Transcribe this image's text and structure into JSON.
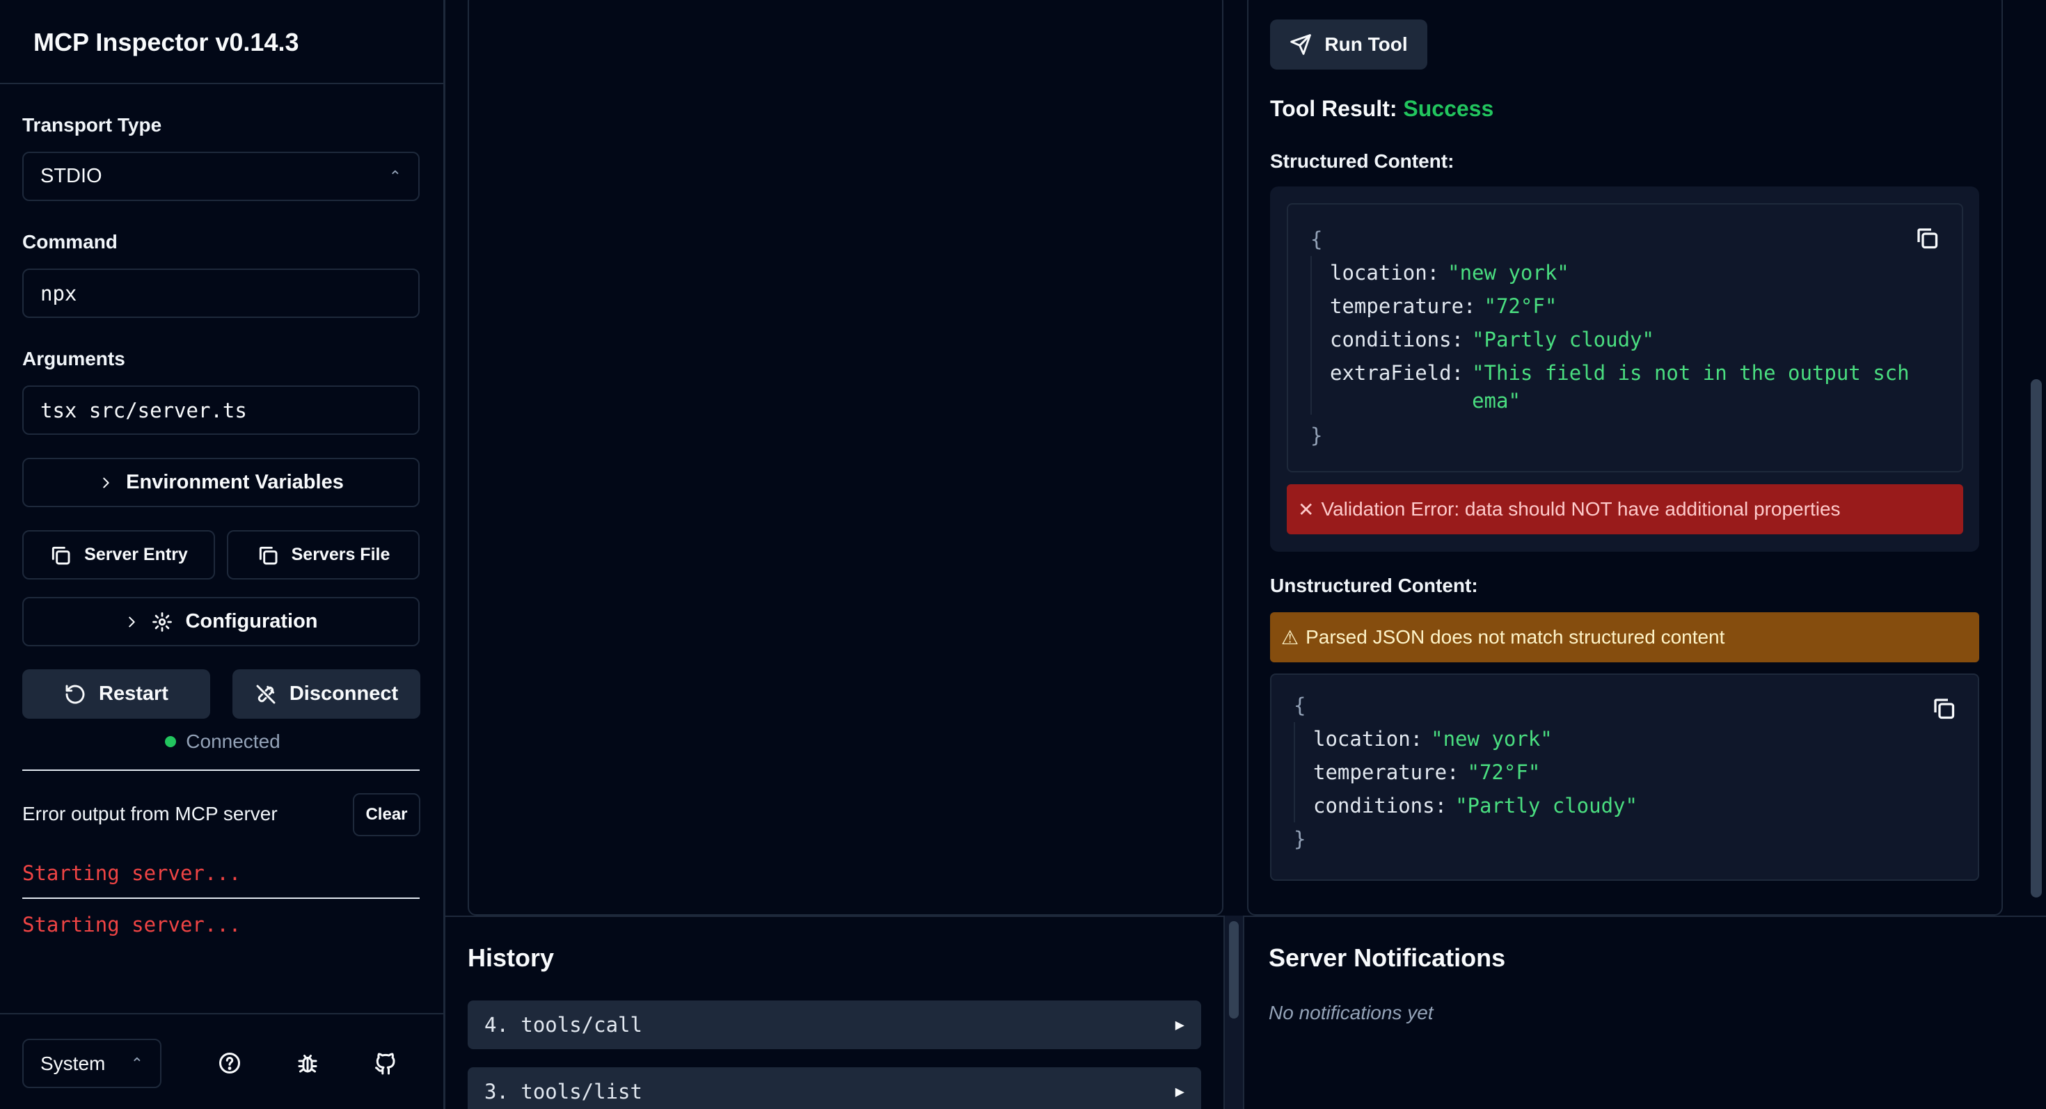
{
  "sidebar": {
    "app_title": "MCP Inspector v0.14.3",
    "transport_label": "Transport Type",
    "transport_value": "STDIO",
    "command_label": "Command",
    "command_value": "npx",
    "arguments_label": "Arguments",
    "arguments_value": "tsx src/server.ts",
    "env_vars_label": "Environment Variables",
    "server_entry_label": "Server Entry",
    "servers_file_label": "Servers File",
    "configuration_label": "Configuration",
    "restart_label": "Restart",
    "disconnect_label": "Disconnect",
    "status_text": "Connected",
    "error_output_title": "Error output from MCP server",
    "clear_label": "Clear",
    "error_lines": [
      "Starting server...",
      "Starting server..."
    ],
    "theme_value": "System"
  },
  "tool": {
    "run_label": "Run Tool",
    "result_label": "Tool Result:",
    "result_status": "Success",
    "structured_title": "Structured Content:",
    "structured": {
      "open": "{",
      "close": "}",
      "rows": [
        {
          "key": "location:",
          "value": "\"new york\""
        },
        {
          "key": "temperature:",
          "value": "\"72°F\""
        },
        {
          "key": "conditions:",
          "value": "\"Partly cloudy\""
        },
        {
          "key": "extraField:",
          "value": "\"This field is not in the output schema\""
        }
      ]
    },
    "validation_error": "Validation Error: data should NOT have additional properties",
    "unstructured_title": "Unstructured Content:",
    "parse_warning": "Parsed JSON does not match structured content",
    "unstructured": {
      "open": "{",
      "close": "}",
      "rows": [
        {
          "key": "location:",
          "value": "\"new york\""
        },
        {
          "key": "temperature:",
          "value": "\"72°F\""
        },
        {
          "key": "conditions:",
          "value": "\"Partly cloudy\""
        }
      ]
    }
  },
  "history": {
    "title": "History",
    "items": [
      {
        "label": "4. tools/call"
      },
      {
        "label": "3. tools/list"
      }
    ]
  },
  "notifications": {
    "title": "Server Notifications",
    "empty_text": "No notifications yet"
  },
  "colors": {
    "background": "#020817",
    "success": "#22c55e",
    "error": "#991b1b",
    "warning": "#854d0e",
    "string_value": "#4ade80"
  }
}
